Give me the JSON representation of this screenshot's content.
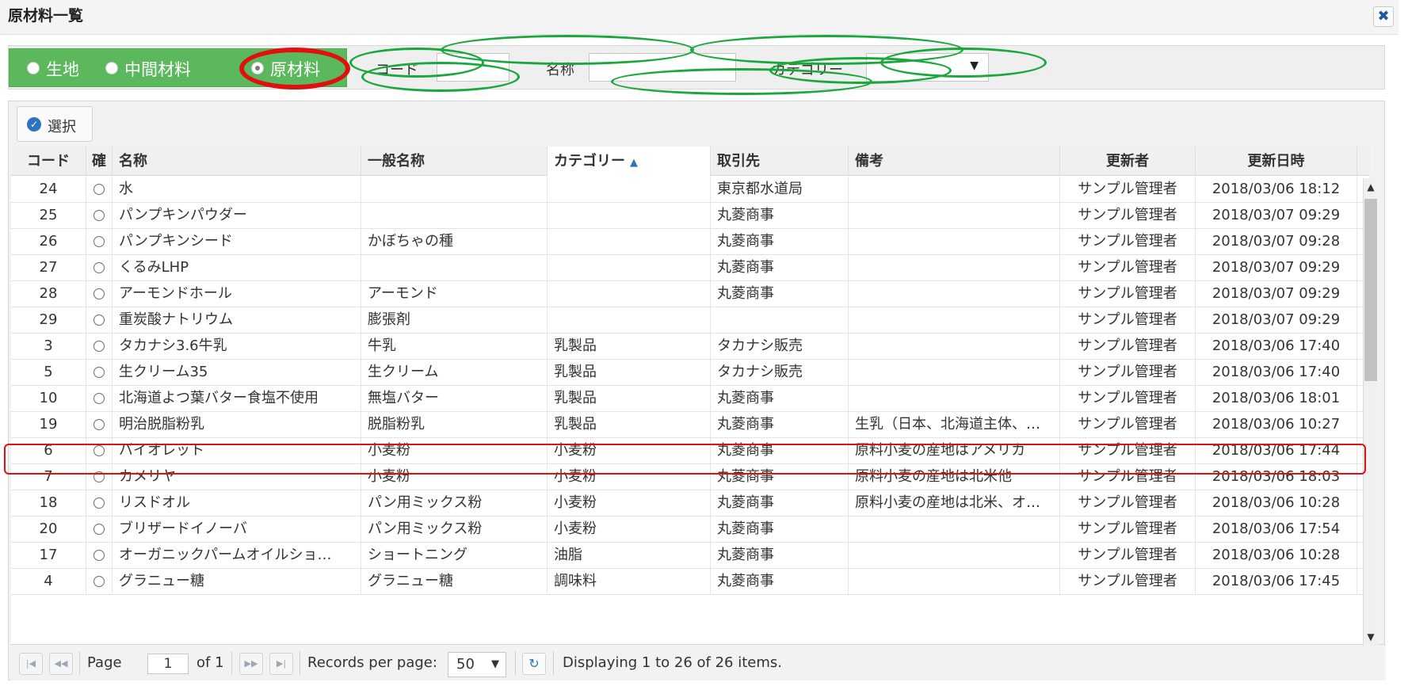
{
  "window": {
    "title": "原材料一覧",
    "close_glyph": "✖"
  },
  "filter": {
    "radios": [
      {
        "label": "生地",
        "selected": false
      },
      {
        "label": "中間材料",
        "selected": false
      },
      {
        "label": "原材料",
        "selected": true
      }
    ],
    "code_label": "コード",
    "code_value": "",
    "name_label": "名称",
    "name_value": "",
    "category_label": "カテゴリー",
    "category_value": ""
  },
  "toolbar": {
    "select_label": "選択",
    "select_icon": "check-circle-icon"
  },
  "table": {
    "columns": [
      "コード",
      "確",
      "名称",
      "一般名称",
      "カテゴリー",
      "取引先",
      "備考",
      "更新者",
      "更新日時"
    ],
    "sorted_column": "カテゴリー",
    "sort_glyph": "▲",
    "rows": [
      [
        "24",
        "",
        "水",
        "",
        "",
        "東京都水道局",
        "",
        "サンプル管理者",
        "2018/03/06 18:12"
      ],
      [
        "25",
        "",
        "パンプキンパウダー",
        "",
        "",
        "丸菱商事",
        "",
        "サンプル管理者",
        "2018/03/07 09:29"
      ],
      [
        "26",
        "",
        "パンプキンシード",
        "かぼちゃの種",
        "",
        "丸菱商事",
        "",
        "サンプル管理者",
        "2018/03/07 09:28"
      ],
      [
        "27",
        "",
        "くるみLHP",
        "",
        "",
        "丸菱商事",
        "",
        "サンプル管理者",
        "2018/03/07 09:29"
      ],
      [
        "28",
        "",
        "アーモンドホール",
        "アーモンド",
        "",
        "丸菱商事",
        "",
        "サンプル管理者",
        "2018/03/07 09:29"
      ],
      [
        "29",
        "",
        "重炭酸ナトリウム",
        "膨張剤",
        "",
        "",
        "",
        "サンプル管理者",
        "2018/03/07 09:29"
      ],
      [
        "3",
        "",
        "タカナシ3.6牛乳",
        "牛乳",
        "乳製品",
        "タカナシ販売",
        "",
        "サンプル管理者",
        "2018/03/06 17:40"
      ],
      [
        "5",
        "",
        "生クリーム35",
        "生クリーム",
        "乳製品",
        "タカナシ販売",
        "",
        "サンプル管理者",
        "2018/03/06 17:40"
      ],
      [
        "10",
        "",
        "北海道よつ葉バター食塩不使用",
        "無塩バター",
        "乳製品",
        "丸菱商事",
        "",
        "サンプル管理者",
        "2018/03/06 18:01"
      ],
      [
        "19",
        "",
        "明治脱脂粉乳",
        "脱脂粉乳",
        "乳製品",
        "丸菱商事",
        "生乳（日本、北海道主体、…",
        "サンプル管理者",
        "2018/03/06 10:27"
      ],
      [
        "6",
        "",
        "バイオレット",
        "小麦粉",
        "小麦粉",
        "丸菱商事",
        "原料小麦の産地はアメリカ",
        "サンプル管理者",
        "2018/03/06 17:44"
      ],
      [
        "7",
        "",
        "カメリヤ",
        "小麦粉",
        "小麦粉",
        "丸菱商事",
        "原料小麦の産地は北米他",
        "サンプル管理者",
        "2018/03/06 18:03"
      ],
      [
        "18",
        "",
        "リスドオル",
        "パン用ミックス粉",
        "小麦粉",
        "丸菱商事",
        "原料小麦の産地は北米、オ…",
        "サンプル管理者",
        "2018/03/06 10:28"
      ],
      [
        "20",
        "",
        "ブリザードイノーバ",
        "パン用ミックス粉",
        "小麦粉",
        "丸菱商事",
        "",
        "サンプル管理者",
        "2018/03/06 17:54"
      ],
      [
        "17",
        "",
        "オーガニックパームオイルショ…",
        "ショートニング",
        "油脂",
        "丸菱商事",
        "",
        "サンプル管理者",
        "2018/03/06 10:28"
      ],
      [
        "4",
        "",
        "グラニュー糖",
        "グラニュー糖",
        "調味料",
        "丸菱商事",
        "",
        "サンプル管理者",
        "2018/03/06 17:45"
      ]
    ]
  },
  "pager": {
    "page_label": "Page",
    "page_value": "1",
    "of_label": "of 1",
    "rpp_label": "Records per page:",
    "rpp_value": "50",
    "display_text": "Displaying 1 to 26 of 26 items."
  },
  "colors": {
    "accent": "#5cb85c",
    "highlight": "#e01010",
    "annotation": "#1aa83c",
    "link": "#2c74c0"
  }
}
